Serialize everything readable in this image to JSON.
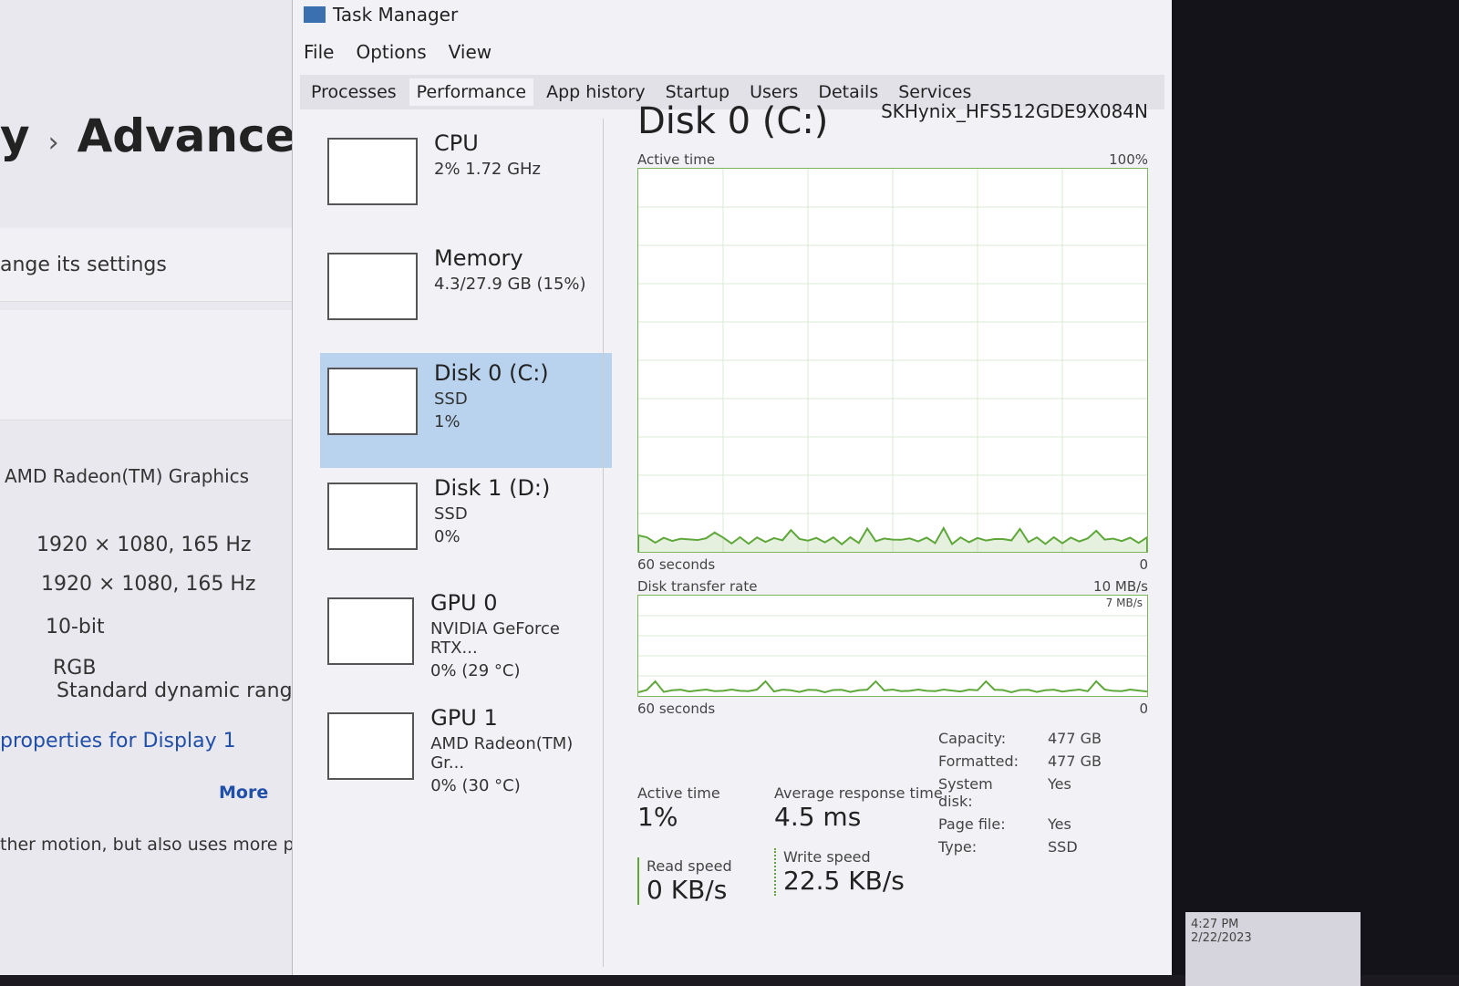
{
  "settings": {
    "breadcrumb_prev": "y",
    "breadcrumb_current": "Advanced",
    "subtitle": "ange its settings",
    "gpu": "AMD Radeon(TM) Graphics",
    "desktop_mode": "1920 × 1080, 165 Hz",
    "active_mode": "1920 × 1080, 165 Hz",
    "bit_depth": "10-bit",
    "color_format": "RGB",
    "color_space": "Standard dynamic range (SDR)",
    "link": "properties for Display 1",
    "motion_text": "ther motion, but also uses more power",
    "more": "More"
  },
  "taskmanager": {
    "title": "Task Manager",
    "menu": [
      "File",
      "Options",
      "View"
    ],
    "tabs": [
      "Processes",
      "Performance",
      "App history",
      "Startup",
      "Users",
      "Details",
      "Services"
    ],
    "active_tab": "Performance",
    "sidebar": [
      {
        "name": "CPU",
        "line1": "2%  1.72 GHz",
        "line2": ""
      },
      {
        "name": "Memory",
        "line1": "4.3/27.9 GB (15%)",
        "line2": ""
      },
      {
        "name": "Disk 0 (C:)",
        "line1": "SSD",
        "line2": "1%"
      },
      {
        "name": "Disk 1 (D:)",
        "line1": "SSD",
        "line2": "0%"
      },
      {
        "name": "GPU 0",
        "line1": "NVIDIA GeForce RTX...",
        "line2": "0% (29 °C)"
      },
      {
        "name": "GPU 1",
        "line1": "AMD Radeon(TM) Gr...",
        "line2": "0% (30 °C)"
      }
    ],
    "selected_index": 2,
    "main": {
      "title": "Disk 0 (C:)",
      "model": "SKHynix_HFS512GDE9X084N",
      "active_graph": {
        "label": "Active time",
        "max": "100%",
        "min": "0",
        "time": "60 seconds"
      },
      "transfer_graph": {
        "label": "Disk transfer rate",
        "max": "10 MB/s",
        "secondary": "7 MB/s",
        "min": "0",
        "time": "60 seconds"
      },
      "stats": {
        "active_time_label": "Active time",
        "active_time": "1%",
        "avg_resp_label": "Average response time",
        "avg_resp": "4.5 ms",
        "read_label": "Read speed",
        "read": "0 KB/s",
        "write_label": "Write speed",
        "write": "22.5 KB/s"
      },
      "props": [
        {
          "k": "Capacity:",
          "v": "477 GB"
        },
        {
          "k": "Formatted:",
          "v": "477 GB"
        },
        {
          "k": "System disk:",
          "v": "Yes"
        },
        {
          "k": "Page file:",
          "v": "Yes"
        },
        {
          "k": "Type:",
          "v": "SSD"
        }
      ]
    }
  },
  "taskbar": {
    "time": "4:27 PM",
    "date": "2/22/2023"
  }
}
